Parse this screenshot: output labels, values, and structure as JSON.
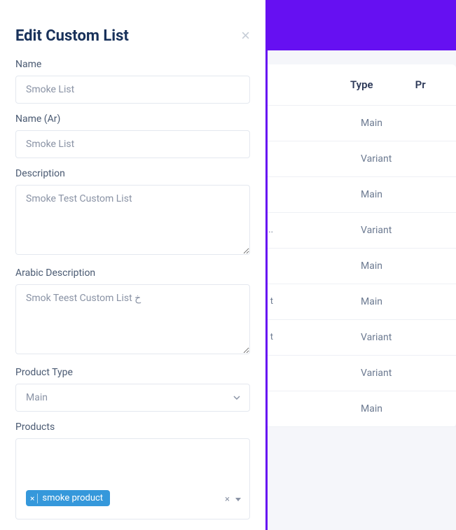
{
  "background": {
    "table_headers": {
      "type": "Type",
      "pr": "Pr"
    },
    "rows": [
      {
        "leftbit": "",
        "type": "Main"
      },
      {
        "leftbit": "",
        "type": "Variant"
      },
      {
        "leftbit": "",
        "type": "Main"
      },
      {
        "leftbit": "i...",
        "type": "Variant"
      },
      {
        "leftbit": "",
        "type": "Main"
      },
      {
        "leftbit": "t",
        "type": "Main"
      },
      {
        "leftbit": "t",
        "type": "Variant"
      },
      {
        "leftbit": "",
        "type": "Variant"
      },
      {
        "leftbit": "",
        "type": "Main"
      }
    ]
  },
  "modal": {
    "title": "Edit Custom List",
    "fields": {
      "name": {
        "label": "Name",
        "value": "Smoke List"
      },
      "name_ar": {
        "label": "Name (Ar)",
        "value": "Smoke List"
      },
      "description": {
        "label": "Description",
        "value": "Smoke Test Custom List"
      },
      "description_ar": {
        "label": "Arabic Description",
        "value": "Smok Teest Custom List خ"
      },
      "product_type": {
        "label": "Product Type",
        "value": "Main"
      },
      "products": {
        "label": "Products",
        "chip": "smoke product"
      }
    }
  }
}
